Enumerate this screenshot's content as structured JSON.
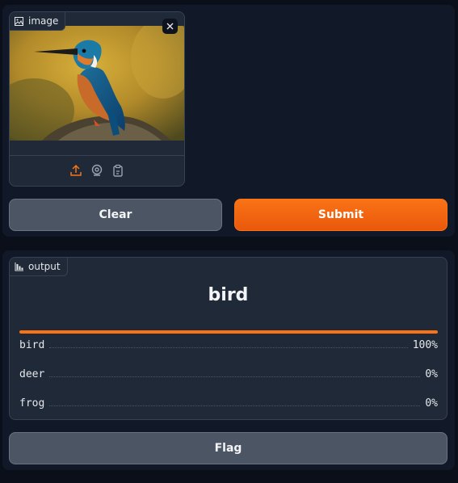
{
  "input": {
    "label": "image",
    "clear_icon": "close-icon",
    "sources": [
      "upload-icon",
      "webcam-icon",
      "clipboard-icon"
    ]
  },
  "buttons": {
    "clear": "Clear",
    "submit": "Submit",
    "flag": "Flag"
  },
  "output": {
    "label": "output",
    "predicted": "bird",
    "confidences": [
      {
        "label": "bird",
        "value": "100%",
        "fraction": 1.0
      },
      {
        "label": "deer",
        "value": "0%",
        "fraction": 0.0
      },
      {
        "label": "frog",
        "value": "0%",
        "fraction": 0.0
      }
    ]
  },
  "colors": {
    "accent": "#f97316",
    "background": "#0b0f19",
    "panel": "#111827",
    "block": "#1f2937",
    "button": "#4b5563"
  }
}
